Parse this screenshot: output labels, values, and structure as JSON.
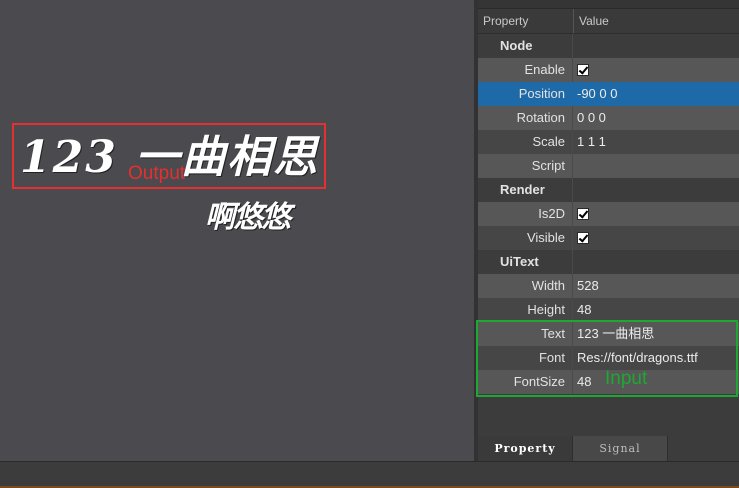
{
  "viewport": {
    "render_line1": "123 一曲相思",
    "render_line2": "啊悠悠",
    "annotation_output": "Output"
  },
  "property_panel": {
    "header": {
      "col1": "Property",
      "col2": "Value"
    },
    "rows": [
      {
        "type": "group",
        "label": "Node"
      },
      {
        "type": "checkbox",
        "label": "Enable",
        "checked": true
      },
      {
        "type": "text",
        "label": "Position",
        "value": "-90 0 0",
        "selected": true
      },
      {
        "type": "text",
        "label": "Rotation",
        "value": "0 0 0"
      },
      {
        "type": "text",
        "label": "Scale",
        "value": "1 1 1"
      },
      {
        "type": "text",
        "label": "Script",
        "value": ""
      },
      {
        "type": "group",
        "label": "Render"
      },
      {
        "type": "checkbox",
        "label": "Is2D",
        "checked": true
      },
      {
        "type": "checkbox",
        "label": "Visible",
        "checked": true
      },
      {
        "type": "group",
        "label": "UiText"
      },
      {
        "type": "text",
        "label": "Width",
        "value": "528"
      },
      {
        "type": "text",
        "label": "Height",
        "value": "48"
      },
      {
        "type": "text",
        "label": "Text",
        "value": "123 一曲相思"
      },
      {
        "type": "text",
        "label": "Font",
        "value": "Res://font/dragons.ttf"
      },
      {
        "type": "text",
        "label": "FontSize",
        "value": "48"
      }
    ],
    "annotation_input": "Input",
    "tabs": [
      {
        "label": "Property",
        "active": true
      },
      {
        "label": "Signal",
        "active": false
      }
    ]
  },
  "colors": {
    "output_annotation": "#e53030",
    "input_annotation": "#1ea832",
    "selection": "#1e6aa8"
  }
}
